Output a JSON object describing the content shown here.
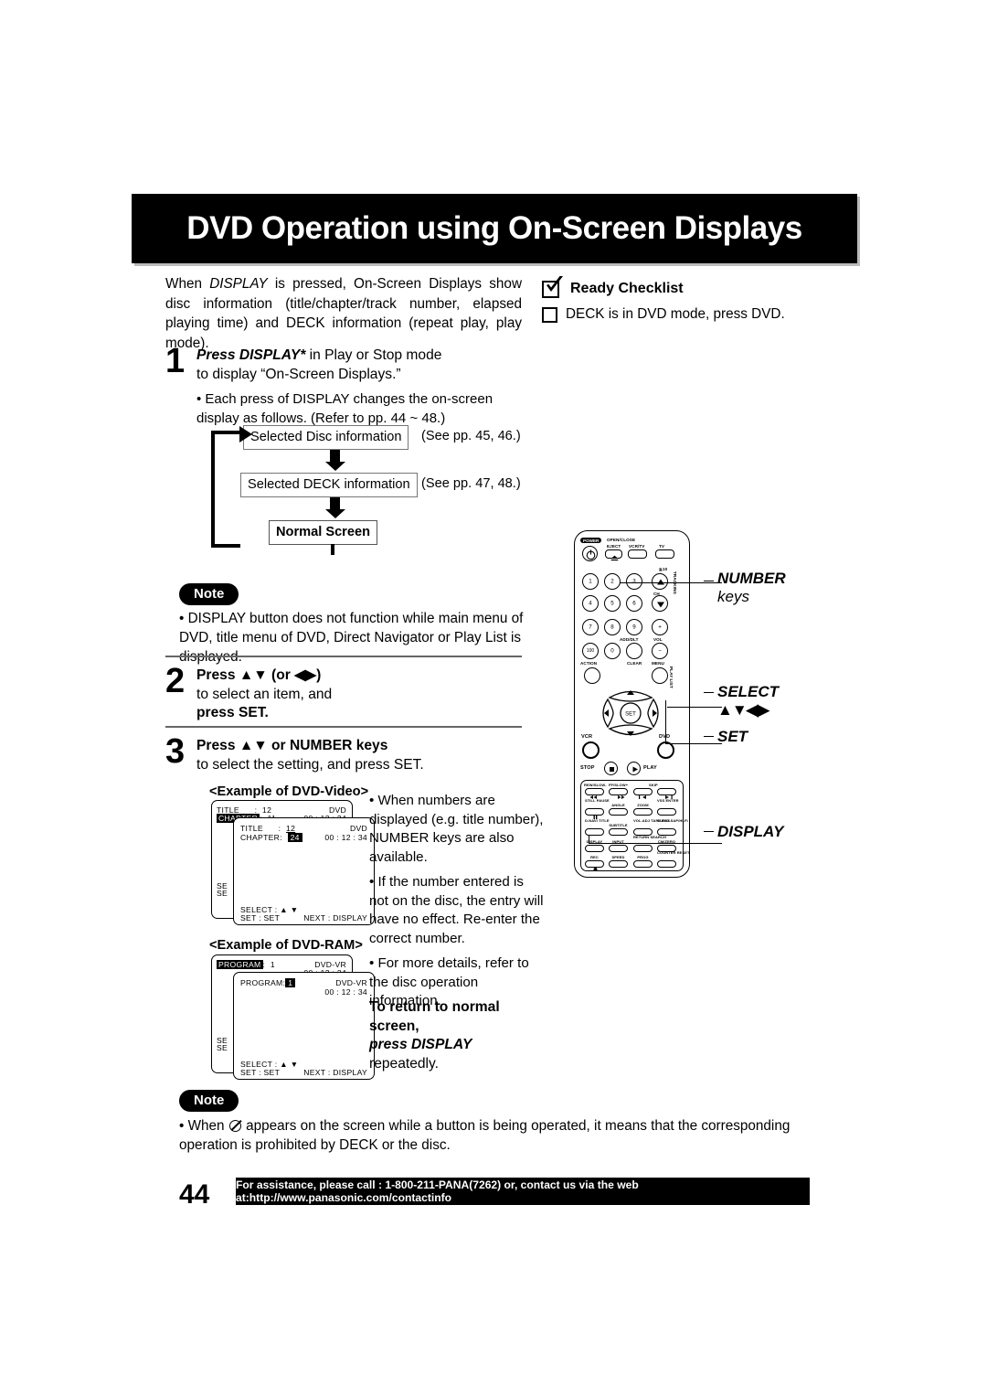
{
  "header": {
    "title": "DVD Operation using On-Screen Displays"
  },
  "intro": {
    "line_pre": "When ",
    "display_italic": "DISPLAY",
    "line_post": " is pressed, On-Screen Displays show disc information (title/chapter/track number, elapsed playing time) and DECK information (repeat play, play mode)."
  },
  "ready_checklist": {
    "title": "Ready Checklist",
    "items": [
      "DECK is in DVD mode, press DVD."
    ]
  },
  "steps": {
    "step1": {
      "num": "1",
      "line1_bold": "Press DISPLAY*",
      "line1_rest": " in Play or Stop mode",
      "line2": "to display “On-Screen Displays.”",
      "bullet": "• Each press of DISPLAY changes the on-screen display as follows. (Refer to pp. 44 ~ 48.)"
    },
    "step2": {
      "num": "2",
      "line1": "Press ▲▼ (or ◀▶)",
      "line2": "to select an item, and",
      "line3": "press SET."
    },
    "step3": {
      "num": "3",
      "line1": "Press ▲▼ or NUMBER keys",
      "line2": "to select the setting, and press SET."
    }
  },
  "flow": {
    "box1": "Selected Disc information",
    "box1_see": "(See pp. 45, 46.)",
    "box2": "Selected DECK information",
    "box2_see": "(See pp. 47, 48.)",
    "box3": "Normal Screen"
  },
  "note1": {
    "badge": "Note",
    "text": "• DISPLAY button does not function while main menu of DVD, title menu of DVD, Direct Navigator or Play List is displayed."
  },
  "examples": {
    "dvd_video": {
      "label": "<Example of DVD-Video>",
      "back": {
        "title_label": "TITLE",
        "title_sep": ":",
        "title_value": "12",
        "chapter_label": "CHAPTER",
        "chapter_sep": ":",
        "chapter_value": "11",
        "disc_type": "DVD",
        "time": "00 : 12 : 34",
        "select_label": "SE",
        "set_label": "SE"
      },
      "front": {
        "title_label": "TITLE",
        "title_sep": ":",
        "title_value": "12",
        "chapter_label": "CHAPTER",
        "chapter_sep": ":",
        "chapter_value": "24",
        "disc_type": "DVD",
        "time": "00 : 12 : 34",
        "select_line": "SELECT : ▲ ▼",
        "set_line": "SET       : SET",
        "next_line": "NEXT : DISPLAY"
      }
    },
    "dvd_ram": {
      "label": "<Example of DVD-RAM>",
      "back": {
        "program_label": "PROGRAM",
        "program_sep": ":",
        "program_value": "1",
        "disc_type": "DVD-VR",
        "time": "00 : 12 : 34",
        "select_label": "SE",
        "set_label": "SE"
      },
      "front": {
        "program_label": "PROGRAM:",
        "program_value": "1",
        "disc_type": "DVD-VR",
        "time": "00 : 12 : 34",
        "select_line": "SELECT : ▲ ▼",
        "set_line": "SET       : SET",
        "next_line": "NEXT : DISPLAY"
      }
    }
  },
  "example_notes": [
    "• When numbers are displayed (e.g. title number), NUMBER keys are also available.",
    "• If the number entered is not on the disc, the entry will have no effect. Re-enter the correct number.",
    "• For more details, refer to the disc operation information."
  ],
  "return_normal": {
    "bold1": "To return to normal",
    "bold2": "screen,",
    "bold3": "press DISPLAY",
    "plain": "repeatedly."
  },
  "remote": {
    "callouts": [
      {
        "line1": "NUMBER",
        "line2": "keys"
      },
      {
        "line1": "SELECT",
        "line2": "▲▼◀▶"
      },
      {
        "line1": "SET",
        "line2": ""
      },
      {
        "line1": "DISPLAY",
        "line2": ""
      }
    ],
    "power_label": "POWER",
    "top_labels": [
      "OPEN/CLOSE",
      "EJECT",
      "VCR/TV",
      "TV"
    ],
    "ge10": "≧10",
    "ch_label": "CH",
    "tracking_label": "TRACKING",
    "numbers": [
      "1",
      "2",
      "3",
      "4",
      "5",
      "6",
      "7",
      "8",
      "9",
      "100",
      "0"
    ],
    "add_dlt": "ADD/DLT",
    "vol": "VOL",
    "clear": "CLEAR",
    "action": "ACTION",
    "menu": "MENU",
    "play_list": "PLAY LIST",
    "set_key": "SET",
    "vcr": "VCR",
    "dvd": "DVD",
    "stop": "STOP",
    "play": "PLAY",
    "panel_rows": [
      [
        "REW/SLOW-",
        "FF/SLOW+",
        "SKIP"
      ],
      [
        "STILL PAUSE",
        "ANGLE",
        "ZOOM",
        "VSS ENTER"
      ],
      [
        "D.NAVI TITLE",
        "SUBTITLE",
        "VOL.ADJ TAPE POS.",
        "AUDIO SAP/HI-FI"
      ],
      [
        "DISPLAY",
        "INPUT",
        "RETURN SEARCH",
        "CM/ZERO"
      ],
      [
        "REC",
        "SPEED",
        "PROG",
        "COUNTER RESET"
      ]
    ]
  },
  "note2": {
    "badge": "Note",
    "text_pre": "• When ",
    "text_post": " appears on the screen while a button is being operated, it means that the corresponding operation is prohibited by DECK or the disc."
  },
  "footer": {
    "page_number": "44",
    "text": "For assistance, please call : 1-800-211-PANA(7262) or, contact us via the web at:http://www.panasonic.com/contactinfo"
  }
}
